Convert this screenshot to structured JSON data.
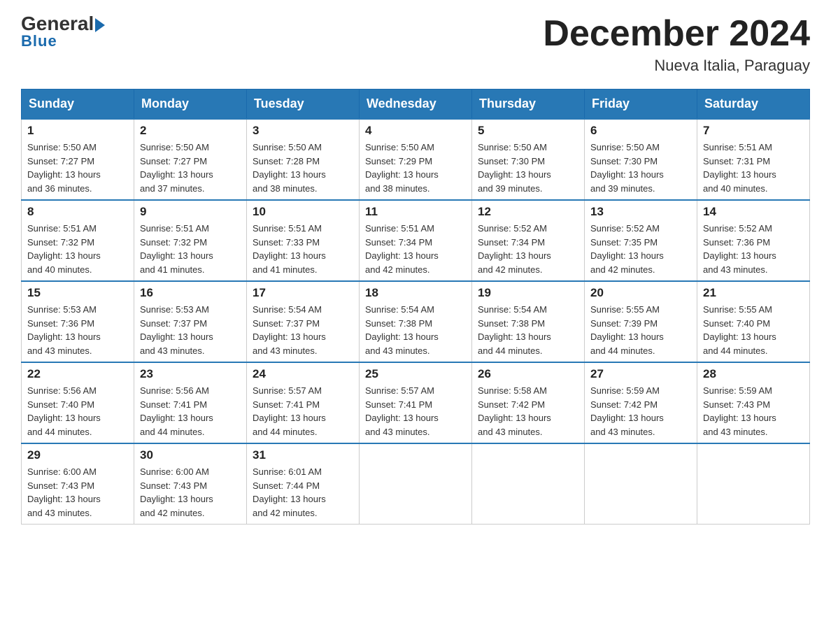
{
  "header": {
    "logo_general": "General",
    "logo_blue": "Blue",
    "month_title": "December 2024",
    "location": "Nueva Italia, Paraguay"
  },
  "days_of_week": [
    "Sunday",
    "Monday",
    "Tuesday",
    "Wednesday",
    "Thursday",
    "Friday",
    "Saturday"
  ],
  "weeks": [
    [
      {
        "day": "1",
        "sunrise": "5:50 AM",
        "sunset": "7:27 PM",
        "daylight": "13 hours and 36 minutes."
      },
      {
        "day": "2",
        "sunrise": "5:50 AM",
        "sunset": "7:27 PM",
        "daylight": "13 hours and 37 minutes."
      },
      {
        "day": "3",
        "sunrise": "5:50 AM",
        "sunset": "7:28 PM",
        "daylight": "13 hours and 38 minutes."
      },
      {
        "day": "4",
        "sunrise": "5:50 AM",
        "sunset": "7:29 PM",
        "daylight": "13 hours and 38 minutes."
      },
      {
        "day": "5",
        "sunrise": "5:50 AM",
        "sunset": "7:30 PM",
        "daylight": "13 hours and 39 minutes."
      },
      {
        "day": "6",
        "sunrise": "5:50 AM",
        "sunset": "7:30 PM",
        "daylight": "13 hours and 39 minutes."
      },
      {
        "day": "7",
        "sunrise": "5:51 AM",
        "sunset": "7:31 PM",
        "daylight": "13 hours and 40 minutes."
      }
    ],
    [
      {
        "day": "8",
        "sunrise": "5:51 AM",
        "sunset": "7:32 PM",
        "daylight": "13 hours and 40 minutes."
      },
      {
        "day": "9",
        "sunrise": "5:51 AM",
        "sunset": "7:32 PM",
        "daylight": "13 hours and 41 minutes."
      },
      {
        "day": "10",
        "sunrise": "5:51 AM",
        "sunset": "7:33 PM",
        "daylight": "13 hours and 41 minutes."
      },
      {
        "day": "11",
        "sunrise": "5:51 AM",
        "sunset": "7:34 PM",
        "daylight": "13 hours and 42 minutes."
      },
      {
        "day": "12",
        "sunrise": "5:52 AM",
        "sunset": "7:34 PM",
        "daylight": "13 hours and 42 minutes."
      },
      {
        "day": "13",
        "sunrise": "5:52 AM",
        "sunset": "7:35 PM",
        "daylight": "13 hours and 42 minutes."
      },
      {
        "day": "14",
        "sunrise": "5:52 AM",
        "sunset": "7:36 PM",
        "daylight": "13 hours and 43 minutes."
      }
    ],
    [
      {
        "day": "15",
        "sunrise": "5:53 AM",
        "sunset": "7:36 PM",
        "daylight": "13 hours and 43 minutes."
      },
      {
        "day": "16",
        "sunrise": "5:53 AM",
        "sunset": "7:37 PM",
        "daylight": "13 hours and 43 minutes."
      },
      {
        "day": "17",
        "sunrise": "5:54 AM",
        "sunset": "7:37 PM",
        "daylight": "13 hours and 43 minutes."
      },
      {
        "day": "18",
        "sunrise": "5:54 AM",
        "sunset": "7:38 PM",
        "daylight": "13 hours and 43 minutes."
      },
      {
        "day": "19",
        "sunrise": "5:54 AM",
        "sunset": "7:38 PM",
        "daylight": "13 hours and 44 minutes."
      },
      {
        "day": "20",
        "sunrise": "5:55 AM",
        "sunset": "7:39 PM",
        "daylight": "13 hours and 44 minutes."
      },
      {
        "day": "21",
        "sunrise": "5:55 AM",
        "sunset": "7:40 PM",
        "daylight": "13 hours and 44 minutes."
      }
    ],
    [
      {
        "day": "22",
        "sunrise": "5:56 AM",
        "sunset": "7:40 PM",
        "daylight": "13 hours and 44 minutes."
      },
      {
        "day": "23",
        "sunrise": "5:56 AM",
        "sunset": "7:41 PM",
        "daylight": "13 hours and 44 minutes."
      },
      {
        "day": "24",
        "sunrise": "5:57 AM",
        "sunset": "7:41 PM",
        "daylight": "13 hours and 44 minutes."
      },
      {
        "day": "25",
        "sunrise": "5:57 AM",
        "sunset": "7:41 PM",
        "daylight": "13 hours and 43 minutes."
      },
      {
        "day": "26",
        "sunrise": "5:58 AM",
        "sunset": "7:42 PM",
        "daylight": "13 hours and 43 minutes."
      },
      {
        "day": "27",
        "sunrise": "5:59 AM",
        "sunset": "7:42 PM",
        "daylight": "13 hours and 43 minutes."
      },
      {
        "day": "28",
        "sunrise": "5:59 AM",
        "sunset": "7:43 PM",
        "daylight": "13 hours and 43 minutes."
      }
    ],
    [
      {
        "day": "29",
        "sunrise": "6:00 AM",
        "sunset": "7:43 PM",
        "daylight": "13 hours and 43 minutes."
      },
      {
        "day": "30",
        "sunrise": "6:00 AM",
        "sunset": "7:43 PM",
        "daylight": "13 hours and 42 minutes."
      },
      {
        "day": "31",
        "sunrise": "6:01 AM",
        "sunset": "7:44 PM",
        "daylight": "13 hours and 42 minutes."
      },
      null,
      null,
      null,
      null
    ]
  ],
  "labels": {
    "sunrise": "Sunrise:",
    "sunset": "Sunset:",
    "daylight": "Daylight:"
  }
}
